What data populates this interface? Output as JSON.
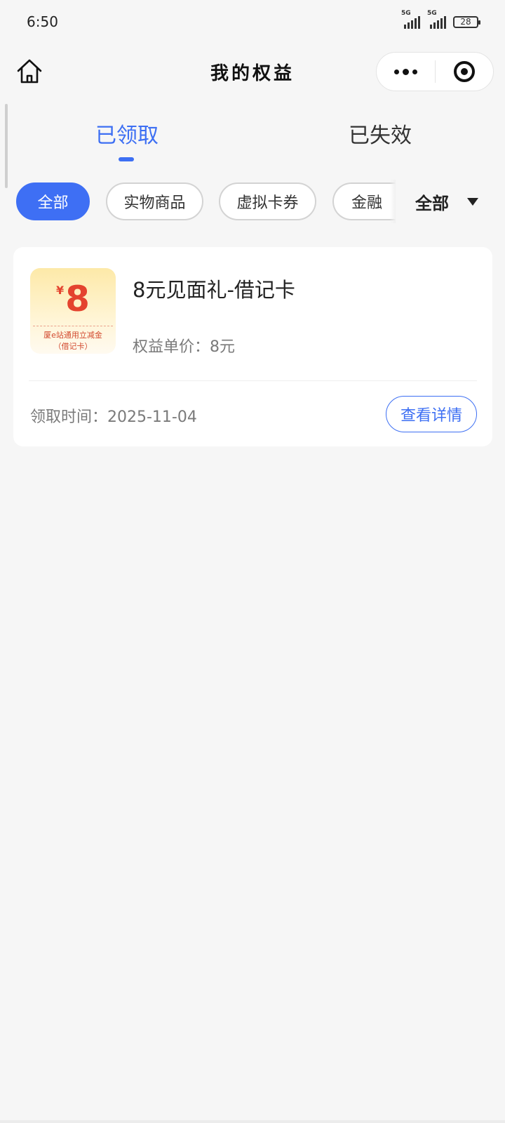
{
  "status_bar": {
    "time": "6:50",
    "signal_1": "5G",
    "signal_2": "5G",
    "battery": "28"
  },
  "nav": {
    "title": "我的权益"
  },
  "tabs": [
    {
      "label": "已领取",
      "active": true
    },
    {
      "label": "已失效",
      "active": false
    }
  ],
  "filters": {
    "chips": [
      {
        "label": "全部",
        "active": true
      },
      {
        "label": "实物商品",
        "active": false
      },
      {
        "label": "虚拟卡券",
        "active": false
      },
      {
        "label": "金融",
        "active": false
      }
    ],
    "dropdown": "全部"
  },
  "card": {
    "coupon": {
      "currency": "¥",
      "amount": "8",
      "desc_line1": "厦e站通用立减金",
      "desc_line2": "（借记卡）"
    },
    "title": "8元见面礼-借记卡",
    "price_text": "权益单价：8元",
    "date_text": "领取时间：2025-11-04",
    "detail_button": "查看详情"
  },
  "colors": {
    "accent": "#3d6ff3",
    "coupon_red": "#e4432e",
    "background": "#f6f6f6"
  }
}
